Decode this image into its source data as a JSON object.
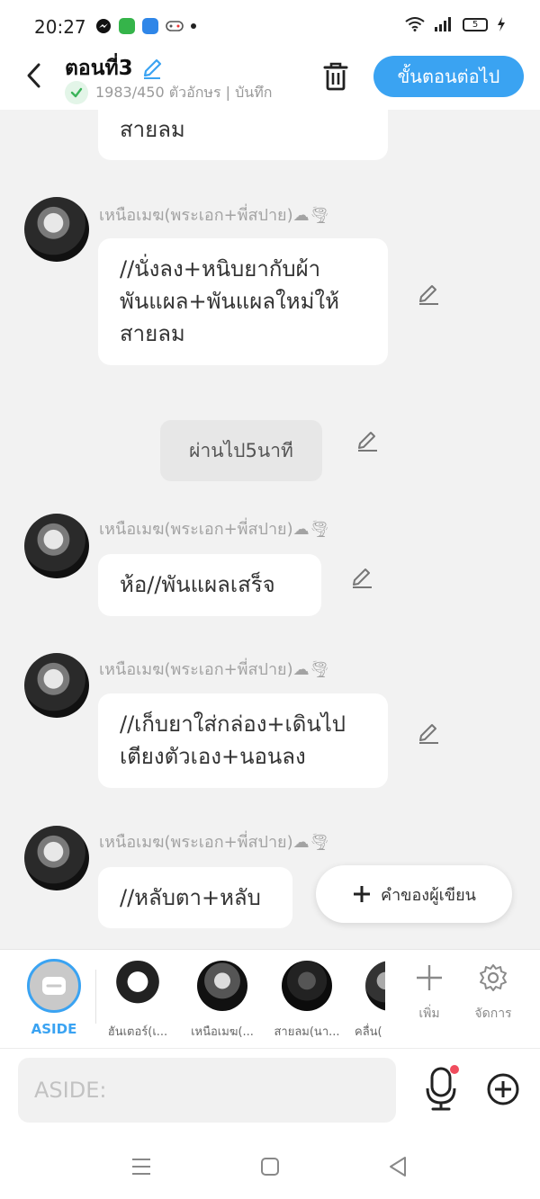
{
  "status": {
    "time": "20:27",
    "battery": "5"
  },
  "header": {
    "episode_title": "ตอนที่3",
    "char_count": "1983/450 ตัวอักษร | บันทึก",
    "next_label": "ขั้นตอนต่อไป"
  },
  "chat": {
    "top_partial": "สายลม",
    "messages": [
      {
        "name": "เหนือเมฆ(พระเอก+พี่สปาย)",
        "text1": "//นั่งลง+หนิบยากับผ้า",
        "text2": "พันแผล+พันแผลใหม่ให้",
        "text3": "สายลม"
      },
      {
        "name": "เหนือเมฆ(พระเอก+พี่สปาย)",
        "text1": "ห้อ//พันแผลเสร็จ"
      },
      {
        "name": "เหนือเมฆ(พระเอก+พี่สปาย)",
        "text1": "//เก็บยาใส่กล่อง+เดินไป",
        "text2": "เตียงตัวเอง+นอนลง"
      },
      {
        "name": "เหนือเมฆ(พระเอก+พี่สปาย)",
        "text1": "//หลับตา+หลับ"
      }
    ],
    "narration": "ผ่านไป5นาที",
    "name_emoji": "☁🌪",
    "writer_button": "คำของผู้เขียน"
  },
  "characters": {
    "aside_label": "ASIDE",
    "items": [
      {
        "label": "ฮันเตอร์(เ..."
      },
      {
        "label": "เหนือเมฆ(..."
      },
      {
        "label": "สายลม(นา..."
      },
      {
        "label": "คลื่น("
      }
    ],
    "add_label": "เพิ่ม",
    "manage_label": "จัดการ"
  },
  "input": {
    "placeholder": "ASIDE:"
  }
}
